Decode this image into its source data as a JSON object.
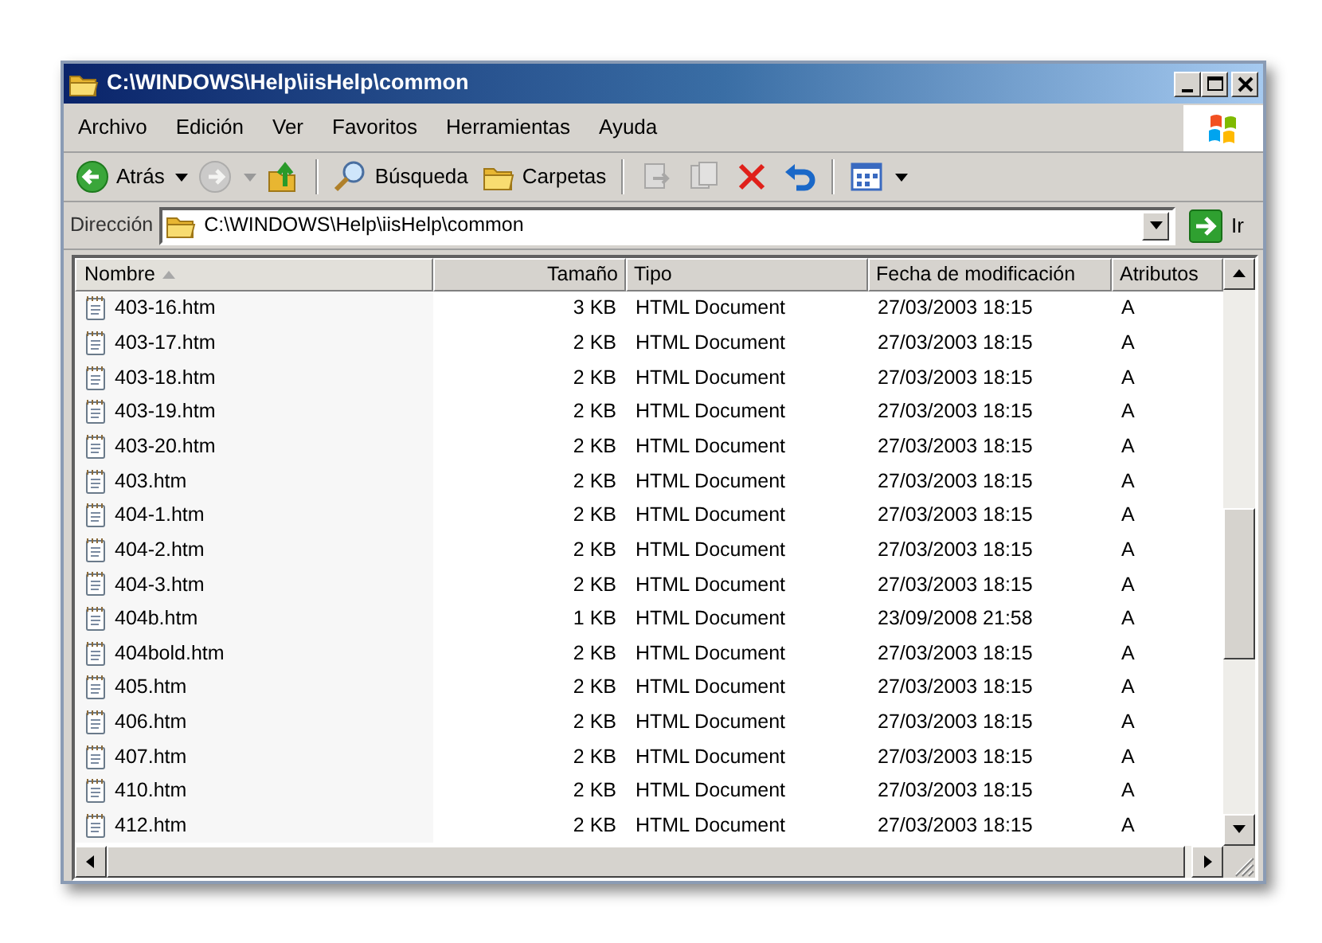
{
  "window": {
    "title": "C:\\WINDOWS\\Help\\iisHelp\\common"
  },
  "menu": [
    "Archivo",
    "Edición",
    "Ver",
    "Favoritos",
    "Herramientas",
    "Ayuda"
  ],
  "toolbar": [
    {
      "kind": "back",
      "label": "Atrás",
      "dropdown": true,
      "disabled": false
    },
    {
      "kind": "forward",
      "dropdown": true,
      "disabled": true
    },
    {
      "kind": "up",
      "disabled": false
    },
    {
      "kind": "separator"
    },
    {
      "kind": "search",
      "label": "Búsqueda",
      "disabled": false
    },
    {
      "kind": "folders",
      "label": "Carpetas",
      "disabled": false
    },
    {
      "kind": "separator"
    },
    {
      "kind": "move",
      "disabled": true
    },
    {
      "kind": "copy",
      "disabled": true
    },
    {
      "kind": "delete",
      "disabled": false
    },
    {
      "kind": "undo",
      "disabled": false
    },
    {
      "kind": "separator"
    },
    {
      "kind": "views",
      "dropdown": true,
      "disabled": false
    }
  ],
  "address": {
    "label": "Dirección",
    "value": "C:\\WINDOWS\\Help\\iisHelp\\common",
    "go_label": "Ir"
  },
  "columns": [
    {
      "label": "Nombre",
      "sorted": true
    },
    {
      "label": "Tamaño",
      "sorted": false
    },
    {
      "label": "Tipo",
      "sorted": false
    },
    {
      "label": "Fecha de modificación",
      "sorted": false
    },
    {
      "label": "Atributos",
      "sorted": false
    }
  ],
  "rows": [
    {
      "name": "403-16.htm",
      "size": "3 KB",
      "type": "HTML Document",
      "modified": "27/03/2003 18:15",
      "attributes": "A"
    },
    {
      "name": "403-17.htm",
      "size": "2 KB",
      "type": "HTML Document",
      "modified": "27/03/2003 18:15",
      "attributes": "A"
    },
    {
      "name": "403-18.htm",
      "size": "2 KB",
      "type": "HTML Document",
      "modified": "27/03/2003 18:15",
      "attributes": "A"
    },
    {
      "name": "403-19.htm",
      "size": "2 KB",
      "type": "HTML Document",
      "modified": "27/03/2003 18:15",
      "attributes": "A"
    },
    {
      "name": "403-20.htm",
      "size": "2 KB",
      "type": "HTML Document",
      "modified": "27/03/2003 18:15",
      "attributes": "A"
    },
    {
      "name": "403.htm",
      "size": "2 KB",
      "type": "HTML Document",
      "modified": "27/03/2003 18:15",
      "attributes": "A"
    },
    {
      "name": "404-1.htm",
      "size": "2 KB",
      "type": "HTML Document",
      "modified": "27/03/2003 18:15",
      "attributes": "A"
    },
    {
      "name": "404-2.htm",
      "size": "2 KB",
      "type": "HTML Document",
      "modified": "27/03/2003 18:15",
      "attributes": "A"
    },
    {
      "name": "404-3.htm",
      "size": "2 KB",
      "type": "HTML Document",
      "modified": "27/03/2003 18:15",
      "attributes": "A"
    },
    {
      "name": "404b.htm",
      "size": "1 KB",
      "type": "HTML Document",
      "modified": "23/09/2008 21:58",
      "attributes": "A"
    },
    {
      "name": "404bold.htm",
      "size": "2 KB",
      "type": "HTML Document",
      "modified": "27/03/2003 18:15",
      "attributes": "A"
    },
    {
      "name": "405.htm",
      "size": "2 KB",
      "type": "HTML Document",
      "modified": "27/03/2003 18:15",
      "attributes": "A"
    },
    {
      "name": "406.htm",
      "size": "2 KB",
      "type": "HTML Document",
      "modified": "27/03/2003 18:15",
      "attributes": "A"
    },
    {
      "name": "407.htm",
      "size": "2 KB",
      "type": "HTML Document",
      "modified": "27/03/2003 18:15",
      "attributes": "A"
    },
    {
      "name": "410.htm",
      "size": "2 KB",
      "type": "HTML Document",
      "modified": "27/03/2003 18:15",
      "attributes": "A"
    },
    {
      "name": "412.htm",
      "size": "2 KB",
      "type": "HTML Document",
      "modified": "27/03/2003 18:15",
      "attributes": "A"
    }
  ]
}
